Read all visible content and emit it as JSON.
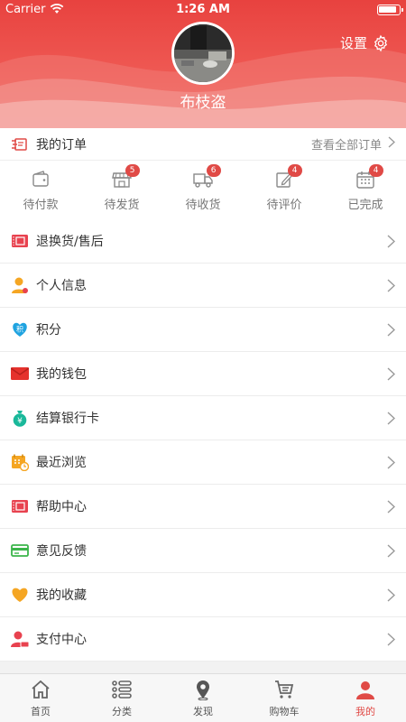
{
  "status_bar": {
    "carrier": "Carrier",
    "time": "1:26 AM"
  },
  "profile": {
    "username": "布枝盗",
    "settings_label": "设置"
  },
  "orders": {
    "title": "我的订单",
    "view_all": "查看全部订单",
    "statuses": [
      {
        "label": "待付款",
        "icon": "wallet-icon",
        "badge": ""
      },
      {
        "label": "待发货",
        "icon": "store-icon",
        "badge": "5"
      },
      {
        "label": "待收货",
        "icon": "truck-icon",
        "badge": "6"
      },
      {
        "label": "待评价",
        "icon": "edit-icon",
        "badge": "4"
      },
      {
        "label": "已完成",
        "icon": "calendar-icon",
        "badge": "4"
      }
    ]
  },
  "menu": [
    {
      "label": "退换货/售后",
      "icon": "return-ticket-icon"
    },
    {
      "label": "个人信息",
      "icon": "person-icon"
    },
    {
      "label": "积分",
      "icon": "points-heart-icon"
    },
    {
      "label": "我的钱包",
      "icon": "envelope-icon"
    },
    {
      "label": "结算银行卡",
      "icon": "money-bag-icon"
    },
    {
      "label": "最近浏览",
      "icon": "calendar-clock-icon"
    },
    {
      "label": "帮助中心",
      "icon": "help-ticket-icon"
    },
    {
      "label": "意见反馈",
      "icon": "card-icon"
    },
    {
      "label": "我的收藏",
      "icon": "heart-icon"
    },
    {
      "label": "支付中心",
      "icon": "pay-user-icon"
    }
  ],
  "tabs": [
    {
      "label": "首页",
      "icon": "home-icon",
      "active": false
    },
    {
      "label": "分类",
      "icon": "list-icon",
      "active": false
    },
    {
      "label": "发现",
      "icon": "location-icon",
      "active": false
    },
    {
      "label": "购物车",
      "icon": "cart-icon",
      "active": false
    },
    {
      "label": "我的",
      "icon": "user-icon",
      "active": true
    }
  ],
  "colors": {
    "accent": "#e04a46",
    "header": "#e8423f",
    "text": "#333333",
    "muted": "#888888"
  }
}
